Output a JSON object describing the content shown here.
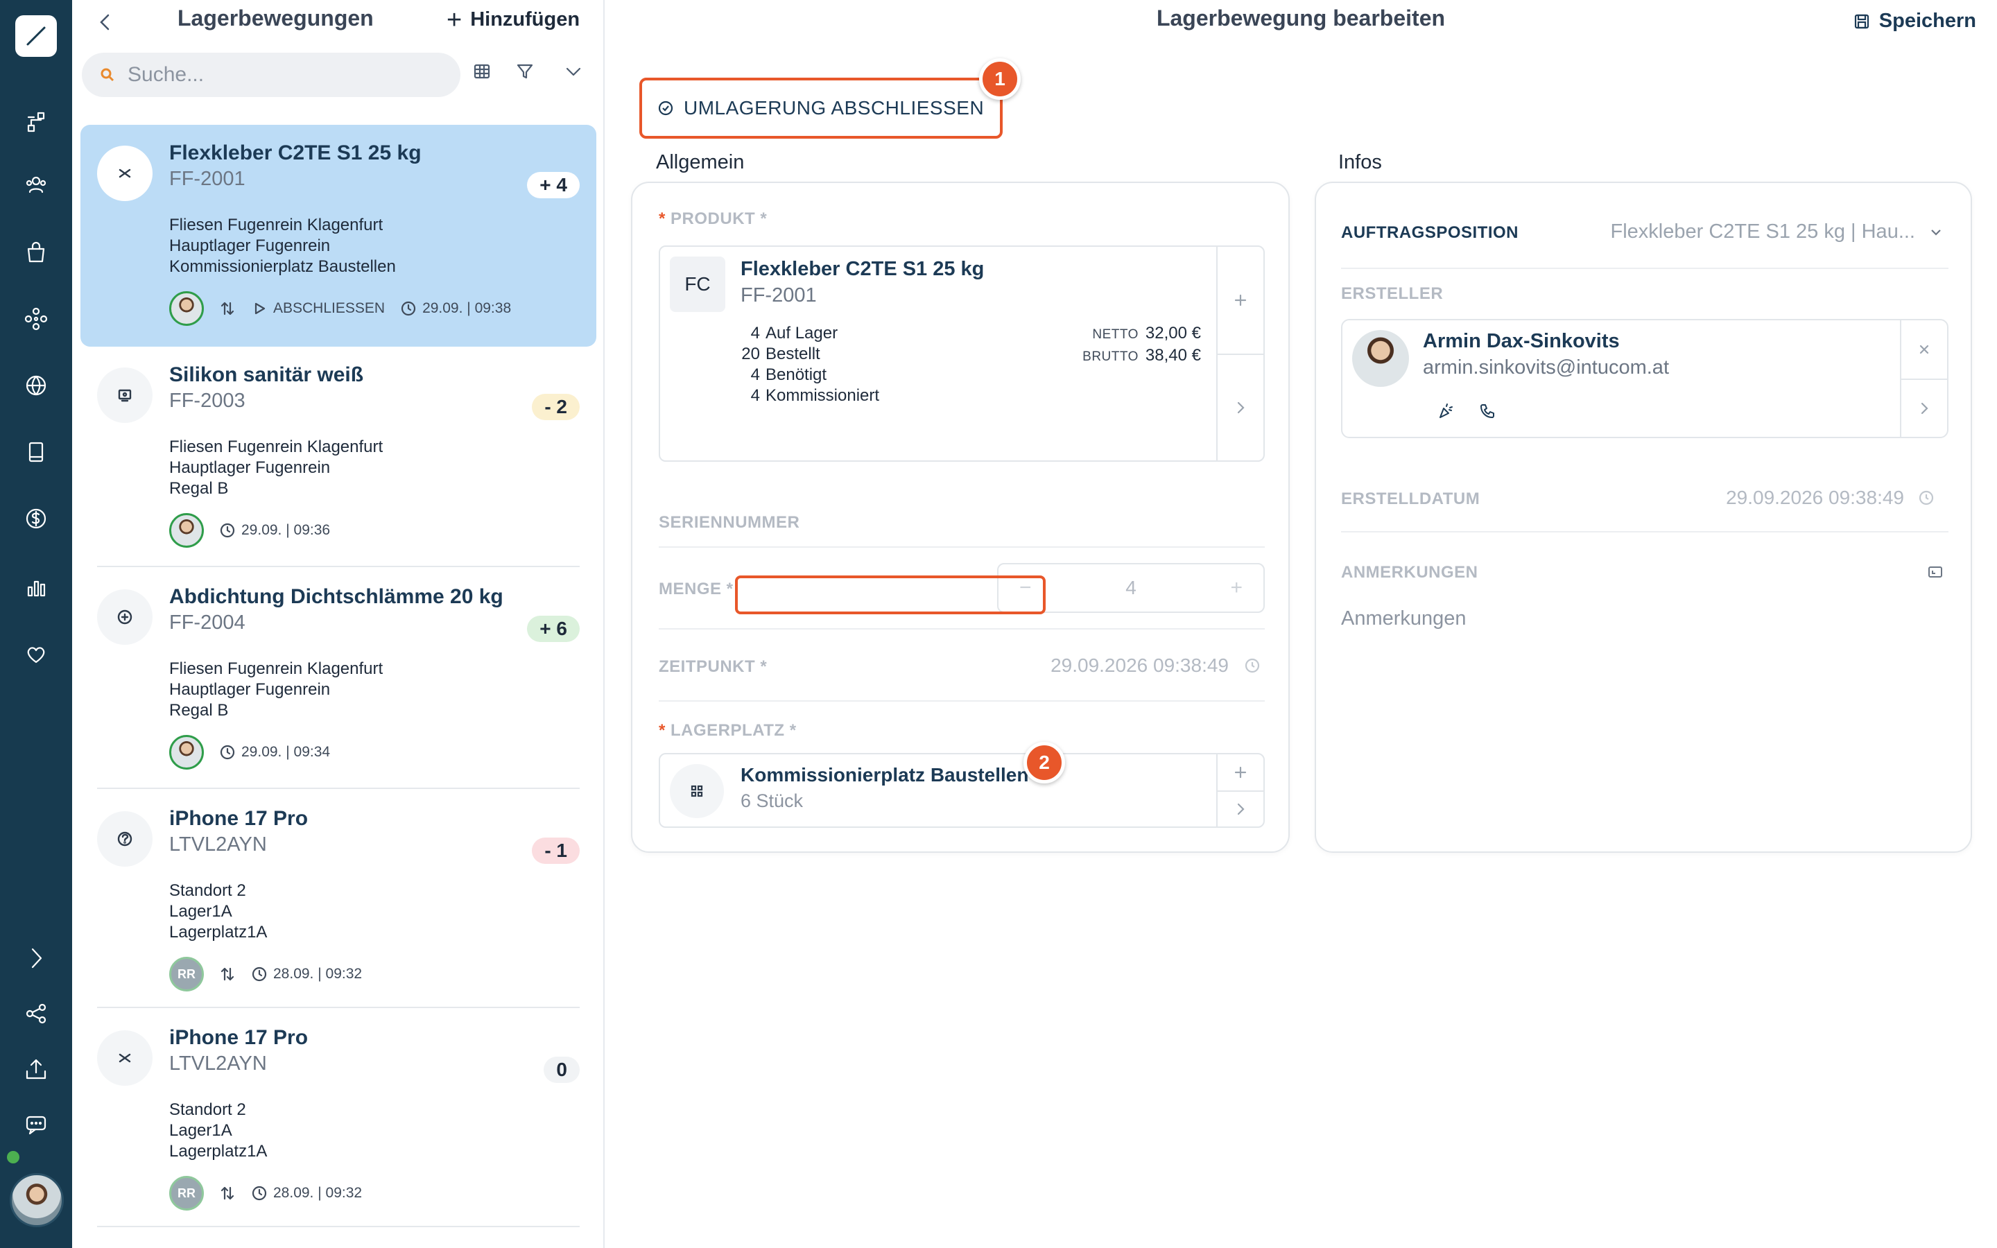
{
  "rail": {
    "icons": [
      "brush-icon",
      "flow-icon",
      "users-icon",
      "bag-icon",
      "network-icon",
      "globe-icon",
      "book-icon",
      "dollar-icon",
      "bar-chart-icon",
      "heart-icon",
      "chevron-right-icon",
      "share-icon",
      "upload-icon",
      "chat-icon"
    ]
  },
  "list": {
    "title": "Lagerbewegungen",
    "add_label": "Hinzufügen",
    "search_placeholder": "Suche...",
    "items": [
      {
        "name": "Flexkleber C2TE S1 25 kg",
        "code": "FF-2001",
        "badge": "+ 4",
        "badge_bg": "#ffffff",
        "badge_fg": "#1e2a3a",
        "location": [
          "Fliesen Fugenrein Klagenfurt",
          "Hauptlager Fugenrein",
          "Kommissionierplatz Baustellen"
        ],
        "action": "ABSCHLIESSEN",
        "time": "29.09. | 09:38"
      },
      {
        "name": "Silikon sanitär weiß",
        "code": "FF-2003",
        "badge": "- 2",
        "badge_bg": "#fbf0cf",
        "badge_fg": "#1e2a3a",
        "location": [
          "Fliesen Fugenrein Klagenfurt",
          "Hauptlager Fugenrein",
          "Regal B"
        ],
        "time": "29.09. | 09:36"
      },
      {
        "name": "Abdichtung Dichtschlämme 20 kg",
        "code": "FF-2004",
        "badge": "+ 6",
        "badge_bg": "#dbf1dc",
        "badge_fg": "#1e2a3a",
        "location": [
          "Fliesen Fugenrein Klagenfurt",
          "Hauptlager Fugenrein",
          "Regal B"
        ],
        "time": "29.09. | 09:34"
      },
      {
        "name": "iPhone 17 Pro",
        "code": "LTVL2AYN",
        "badge": "- 1",
        "badge_bg": "#fbdde0",
        "badge_fg": "#1e2a3a",
        "location": [
          "Standort 2",
          "Lager1A",
          "Lagerplatz1A"
        ],
        "avatar": "RR",
        "time": "28.09. | 09:32"
      },
      {
        "name": "iPhone 17 Pro",
        "code": "LTVL2AYN",
        "badge": "0",
        "badge_bg": "#f1f3f5",
        "badge_fg": "#1e2a3a",
        "location": [
          "Standort 2",
          "Lager1A",
          "Lagerplatz1A"
        ],
        "avatar": "RR",
        "time": "28.09. | 09:32"
      }
    ]
  },
  "main": {
    "title": "Lagerbewegung bearbeiten",
    "save_label": "Speichern",
    "cta_label": "UMLAGERUNG ABSCHLIESSEN",
    "markers": [
      "1",
      "2"
    ],
    "section_general": "Allgemein",
    "section_infos": "Infos",
    "product_label": "PRODUKT",
    "product": {
      "initials": "FC",
      "name": "Flexkleber C2TE S1 25 kg",
      "code": "FF-2001",
      "stock": [
        {
          "num": "4",
          "label": "Auf Lager"
        },
        {
          "num": "20",
          "label": "Bestellt"
        },
        {
          "num": "4",
          "label": "Benötigt"
        },
        {
          "num": "4",
          "label": "Kommissioniert"
        }
      ],
      "netto_label": "NETTO",
      "netto": "32,00 €",
      "brutto_label": "BRUTTO",
      "brutto": "38,40 €"
    },
    "serial_label": "SERIENNUMMER",
    "quantity_label": "MENGE *",
    "quantity": "4",
    "timestamp_label": "ZEITPUNKT *",
    "timestamp": "29.09.2026 09:38:49",
    "storage_label": "LAGERPLATZ",
    "storage": {
      "name": "Kommissionierplatz Baustellen",
      "sub": "6 Stück"
    },
    "infos": {
      "order_position_label": "AUFTRAGSPOSITION",
      "order_position_value": "Flexkleber C2TE S1 25 kg | Hau...",
      "creator_label": "ERSTELLER",
      "creator_name": "Armin Dax-Sinkovits",
      "creator_email": "armin.sinkovits@intucom.at",
      "created_label": "ERSTELLDATUM",
      "created_value": "29.09.2026 09:38:49",
      "notes_label": "ANMERKUNGEN",
      "notes_placeholder": "Anmerkungen"
    }
  }
}
